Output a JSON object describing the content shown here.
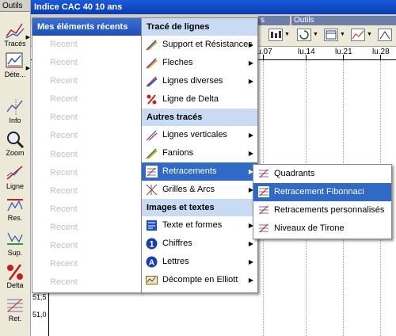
{
  "toolbar": {
    "header": "Outils",
    "tools": [
      {
        "label": "Tracés",
        "icon": "pencil-lines-icon"
      },
      {
        "label": "Déte...",
        "icon": "detect-chart-icon"
      },
      {
        "label": "Info",
        "icon": "info-chart-icon"
      },
      {
        "label": "Zoom",
        "icon": "magnifier-icon"
      },
      {
        "label": "Ligne",
        "icon": "line-icon"
      },
      {
        "label": "Res.",
        "icon": "resistance-icon"
      },
      {
        "label": "Sup.",
        "icon": "support-icon"
      },
      {
        "label": "Delta",
        "icon": "percent-delta-icon"
      },
      {
        "label": "Ret.",
        "icon": "retracement-icon"
      }
    ]
  },
  "window": {
    "title": "Indice CAC 40  10 ans",
    "tab_right": "Outils",
    "tab_left": "s"
  },
  "axis": {
    "dates": [
      "lu.07",
      "lu.14",
      "lu.21",
      "lu.28"
    ],
    "prices": [
      "51,5",
      "51,0"
    ]
  },
  "menus": {
    "recent": {
      "title": "Mes éléments récents",
      "items": [
        "Recent",
        "Recent",
        "Recent",
        "Recent",
        "Recent",
        "Recent",
        "Recent",
        "Recent",
        "Recent",
        "Recent",
        "Recent",
        "Recent",
        "Recent",
        "Recent"
      ]
    },
    "main": {
      "sections": [
        {
          "title": "Tracé de lignes",
          "items": [
            {
              "label": "Support et Résistances",
              "icon": "support-resistance-icon",
              "submenu": true
            },
            {
              "label": "Fleches",
              "icon": "arrow-pen-icon",
              "submenu": true
            },
            {
              "label": "Lignes diverses",
              "icon": "lines-pen-icon",
              "submenu": true
            },
            {
              "label": "Ligne de Delta",
              "icon": "delta-percent-icon",
              "submenu": false
            }
          ]
        },
        {
          "title": "Autres tracés",
          "items": [
            {
              "label": "Lignes verticales",
              "icon": "vertical-lines-icon",
              "submenu": true
            },
            {
              "label": "Fanions",
              "icon": "flag-pen-icon",
              "submenu": true
            },
            {
              "label": "Retracements",
              "icon": "retracement-icon",
              "submenu": true,
              "highlighted": true
            },
            {
              "label": "Grilles & Arcs",
              "icon": "grid-arc-icon",
              "submenu": true
            }
          ]
        },
        {
          "title": "Images et textes",
          "items": [
            {
              "label": "Texte et formes",
              "icon": "text-shapes-icon",
              "submenu": true
            },
            {
              "label": "Chiffres",
              "icon": "number-one-icon",
              "submenu": true
            },
            {
              "label": "Lettres",
              "icon": "letter-a-icon",
              "submenu": true
            },
            {
              "label": "Décompte en Elliott",
              "icon": "elliott-count-icon",
              "submenu": true
            }
          ]
        }
      ]
    },
    "submenu": {
      "items": [
        {
          "label": "Quadrants",
          "icon": "quadrants-icon"
        },
        {
          "label": "Retracement Fibonnaci",
          "icon": "fibonacci-icon",
          "highlighted": true
        },
        {
          "label": "Retracements personnalisés",
          "icon": "custom-retracement-icon"
        },
        {
          "label": "Niveaux de Tirone",
          "icon": "tirone-levels-icon"
        }
      ]
    }
  },
  "colors": {
    "titlebar": "#0a3cb0",
    "highlight": "#316ac5",
    "section_header": "#c9dbf3",
    "recent_disabled": "#c0c0c0"
  }
}
